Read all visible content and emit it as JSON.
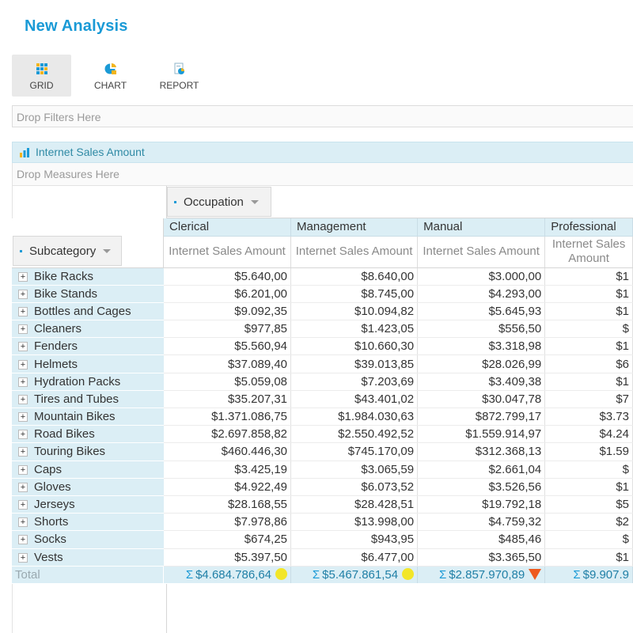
{
  "app": {
    "title": "New Analysis"
  },
  "toolbar": {
    "buttons": [
      {
        "label": "GRID",
        "icon": "grid-icon",
        "active": true
      },
      {
        "label": "CHART",
        "icon": "chart-icon",
        "active": false
      },
      {
        "label": "REPORT",
        "icon": "report-icon",
        "active": false
      }
    ]
  },
  "filters": {
    "placeholder": "Drop Filters Here"
  },
  "measures": {
    "active": "Internet Sales Amount",
    "icon": "bar-chart-icon",
    "placeholder": "Drop Measures Here"
  },
  "pivot": {
    "column_field": "Occupation",
    "row_field": "Subcategory",
    "columns": [
      "Clerical",
      "Management",
      "Manual",
      "Professional"
    ],
    "measure_label": "Internet Sales Amount",
    "rows": [
      {
        "label": "Bike Racks",
        "values": [
          "$5.640,00",
          "$8.640,00",
          "$3.000,00",
          "$1"
        ]
      },
      {
        "label": "Bike Stands",
        "values": [
          "$6.201,00",
          "$8.745,00",
          "$4.293,00",
          "$1"
        ]
      },
      {
        "label": "Bottles and Cages",
        "values": [
          "$9.092,35",
          "$10.094,82",
          "$5.645,93",
          "$1"
        ]
      },
      {
        "label": "Cleaners",
        "values": [
          "$977,85",
          "$1.423,05",
          "$556,50",
          "$"
        ]
      },
      {
        "label": "Fenders",
        "values": [
          "$5.560,94",
          "$10.660,30",
          "$3.318,98",
          "$1"
        ]
      },
      {
        "label": "Helmets",
        "values": [
          "$37.089,40",
          "$39.013,85",
          "$28.026,99",
          "$6"
        ]
      },
      {
        "label": "Hydration Packs",
        "values": [
          "$5.059,08",
          "$7.203,69",
          "$3.409,38",
          "$1"
        ]
      },
      {
        "label": "Tires and Tubes",
        "values": [
          "$35.207,31",
          "$43.401,02",
          "$30.047,78",
          "$7"
        ]
      },
      {
        "label": "Mountain Bikes",
        "values": [
          "$1.371.086,75",
          "$1.984.030,63",
          "$872.799,17",
          "$3.73"
        ]
      },
      {
        "label": "Road Bikes",
        "values": [
          "$2.697.858,82",
          "$2.550.492,52",
          "$1.559.914,97",
          "$4.24"
        ]
      },
      {
        "label": "Touring Bikes",
        "values": [
          "$460.446,30",
          "$745.170,09",
          "$312.368,13",
          "$1.59"
        ]
      },
      {
        "label": "Caps",
        "values": [
          "$3.425,19",
          "$3.065,59",
          "$2.661,04",
          "$"
        ]
      },
      {
        "label": "Gloves",
        "values": [
          "$4.922,49",
          "$6.073,52",
          "$3.526,56",
          "$1"
        ]
      },
      {
        "label": "Jerseys",
        "values": [
          "$28.168,55",
          "$28.428,51",
          "$19.792,18",
          "$5"
        ]
      },
      {
        "label": "Shorts",
        "values": [
          "$7.978,86",
          "$13.998,00",
          "$4.759,32",
          "$2"
        ]
      },
      {
        "label": "Socks",
        "values": [
          "$674,25",
          "$943,95",
          "$485,46",
          "$"
        ]
      },
      {
        "label": "Vests",
        "values": [
          "$5.397,50",
          "$6.477,00",
          "$3.365,50",
          "$1"
        ]
      }
    ],
    "total": {
      "label": "Total",
      "sigma": "Σ",
      "values": [
        "$4.684.786,64",
        "$5.467.861,54",
        "$2.857.970,89",
        "$9.907.9"
      ],
      "indicators": [
        "yellow-circle-icon",
        "yellow-circle-icon",
        "orange-down-triangle-icon",
        ""
      ]
    }
  },
  "colors": {
    "accent": "#1a9ad6",
    "header_bg": "#dbeef5",
    "indicator_yellow": "#f2e629",
    "indicator_orange": "#ee5a1f"
  }
}
